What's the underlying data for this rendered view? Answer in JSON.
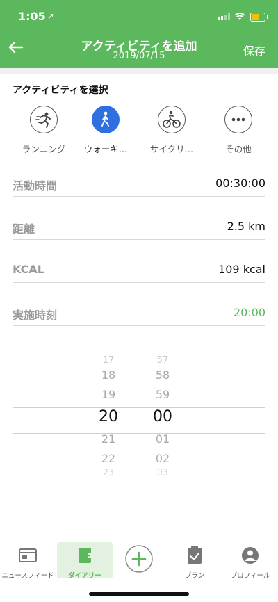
{
  "status_bar": {
    "time": "1:05",
    "location_arrow": "➚"
  },
  "header": {
    "title": "アクティビティを追加",
    "date": "2019/07/15",
    "save_label": "保存",
    "back_icon": "back-arrow-icon",
    "background_color": "#5cb85c"
  },
  "activity_section": {
    "label": "アクティビティを選択",
    "items": [
      {
        "label": "ランニング",
        "icon": "running-icon",
        "selected": false
      },
      {
        "label": "ウォーキ…",
        "icon": "walking-icon",
        "selected": true
      },
      {
        "label": "サイクリ…",
        "icon": "cycling-icon",
        "selected": false
      },
      {
        "label": "その他",
        "icon": "more-icon",
        "selected": false
      }
    ],
    "selected_color": "#2f6fe0"
  },
  "fields": [
    {
      "label": "活動時間",
      "value": "00:30:00"
    },
    {
      "label": "距離",
      "value": "2.5 km"
    },
    {
      "label": "KCAL",
      "value": "109 kcal"
    },
    {
      "label": "実施時刻",
      "value": "20:00",
      "highlight": true
    }
  ],
  "time_picker": {
    "hours": [
      "17",
      "18",
      "19",
      "20",
      "21",
      "22",
      "23"
    ],
    "minutes": [
      "57",
      "58",
      "59",
      "00",
      "01",
      "02",
      "03"
    ],
    "selected_hour": "20",
    "selected_minute": "00"
  },
  "tab_bar": [
    {
      "label": "ニュースフィード",
      "icon": "newsfeed-icon",
      "active": false
    },
    {
      "label": "ダイアリー",
      "icon": "diary-icon",
      "active": true
    },
    {
      "label": "",
      "icon": "add-plus-icon",
      "active": false
    },
    {
      "label": "プラン",
      "icon": "clipboard-check-icon",
      "active": false
    },
    {
      "label": "プロフィール",
      "icon": "profile-icon",
      "active": false
    }
  ]
}
